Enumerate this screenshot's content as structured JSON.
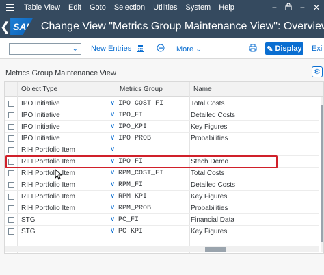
{
  "menubar": {
    "items": [
      "Table View",
      "Edit",
      "Goto",
      "Selection",
      "Utilities",
      "System",
      "Help"
    ]
  },
  "title": "Change View \"Metrics Group Maintenance View\": Overview",
  "logo": "SAP",
  "toolbar": {
    "new_entries": "New Entries",
    "more": "More",
    "display": "Display",
    "exit": "Exi"
  },
  "section_title": "Metrics Group Maintenance View",
  "table": {
    "headers": [
      "Object Type",
      "Metrics Group",
      "Name"
    ],
    "rows": [
      {
        "object_type": "IPO Initiative",
        "metrics_group": "IPO_COST_FI",
        "name": "Total Costs"
      },
      {
        "object_type": "IPO Initiative",
        "metrics_group": "IPO_FI",
        "name": "Detailed Costs"
      },
      {
        "object_type": "IPO Initiative",
        "metrics_group": "IPO_KPI",
        "name": "Key Figures"
      },
      {
        "object_type": "IPO Initiative",
        "metrics_group": "IPO_PROB",
        "name": "Probabilities"
      },
      {
        "object_type": "RIH Portfolio Item",
        "metrics_group": "",
        "name": ""
      },
      {
        "object_type": "RIH Portfolio Item",
        "metrics_group": "IPO_FI",
        "name": "Stech Demo"
      },
      {
        "object_type": "RIH Portfolio Item",
        "metrics_group": "RPM_COST_FI",
        "name": "Total Costs"
      },
      {
        "object_type": "RIH Portfolio Item",
        "metrics_group": "RPM_FI",
        "name": "Detailed Costs"
      },
      {
        "object_type": "RIH Portfolio Item",
        "metrics_group": "RPM_KPI",
        "name": "Key Figures"
      },
      {
        "object_type": "RIH Portfolio Item",
        "metrics_group": "RPM_PROB",
        "name": "Probabilities"
      },
      {
        "object_type": "STG",
        "metrics_group": "PC_FI",
        "name": "Financial Data"
      },
      {
        "object_type": "STG",
        "metrics_group": "PC_KPI",
        "name": "Key Figures"
      }
    ],
    "highlighted_row": 5
  },
  "colors": {
    "shell": "#354a5f",
    "accent": "#0a6ed1",
    "highlight": "#d0202a"
  },
  "icons": [
    "hamburger-icon",
    "back-icon",
    "lock-icon",
    "minimize-icon",
    "close-icon",
    "print-icon",
    "settings-icon",
    "calculator-icon",
    "minus-circle-icon",
    "chevron-down-icon"
  ]
}
